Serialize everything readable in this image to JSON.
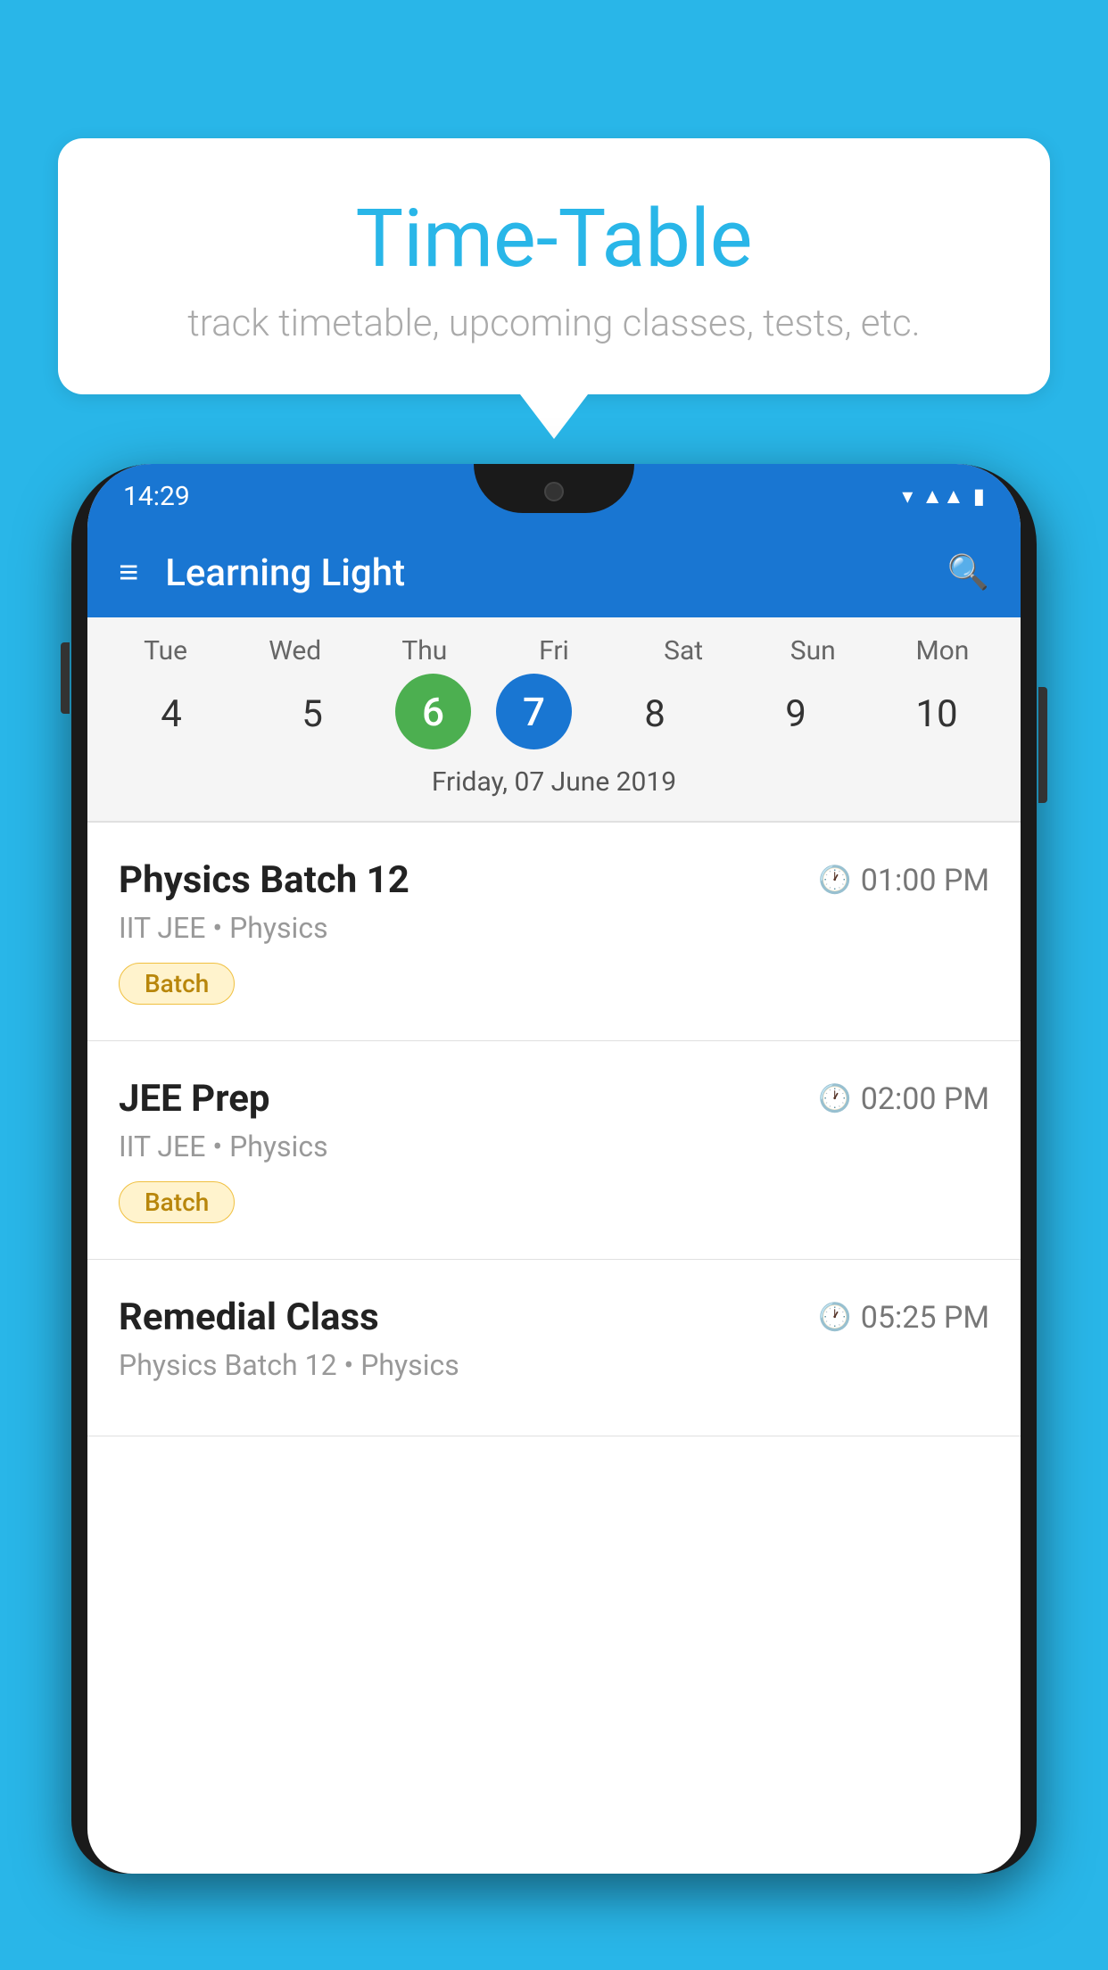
{
  "background_color": "#29b6e8",
  "speech_bubble": {
    "title": "Time-Table",
    "subtitle": "track timetable, upcoming classes, tests, etc."
  },
  "phone": {
    "status_bar": {
      "time": "14:29"
    },
    "app_bar": {
      "title": "Learning Light"
    },
    "calendar": {
      "days": [
        {
          "abbr": "Tue",
          "num": "4"
        },
        {
          "abbr": "Wed",
          "num": "5"
        },
        {
          "abbr": "Thu",
          "num": "6",
          "state": "today_prev"
        },
        {
          "abbr": "Fri",
          "num": "7",
          "state": "selected"
        },
        {
          "abbr": "Sat",
          "num": "8"
        },
        {
          "abbr": "Sun",
          "num": "9"
        },
        {
          "abbr": "Mon",
          "num": "10"
        }
      ],
      "selected_date_label": "Friday, 07 June 2019"
    },
    "schedule": [
      {
        "name": "Physics Batch 12",
        "time": "01:00 PM",
        "sub": "IIT JEE • Physics",
        "badge": "Batch"
      },
      {
        "name": "JEE Prep",
        "time": "02:00 PM",
        "sub": "IIT JEE • Physics",
        "badge": "Batch"
      },
      {
        "name": "Remedial Class",
        "time": "05:25 PM",
        "sub": "Physics Batch 12 • Physics",
        "badge": null
      }
    ]
  }
}
